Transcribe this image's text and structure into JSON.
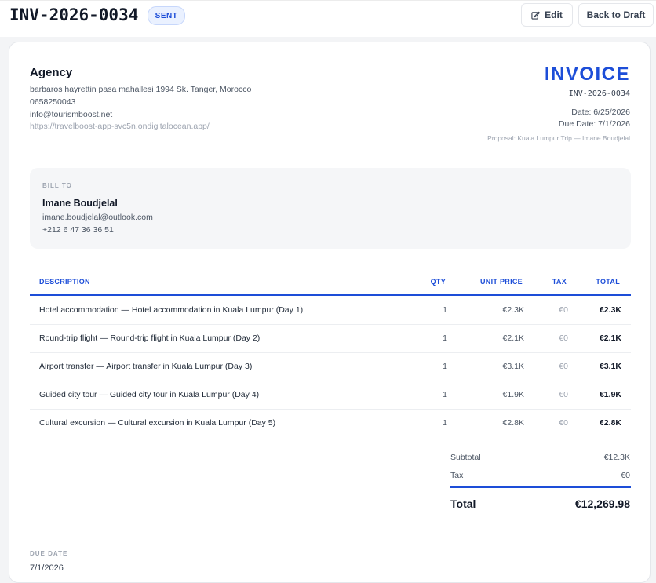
{
  "header": {
    "invoice_id": "INV-2026-0034",
    "status": "SENT",
    "edit_label": "Edit",
    "back_label": "Back to Draft"
  },
  "agency": {
    "name": "Agency",
    "address": "barbaros hayrettin pasa mahallesi 1994 Sk. Tanger, Morocco",
    "phone": "0658250043",
    "email": "info@tourismboost.net",
    "website": "https://travelboost-app-svc5n.ondigitalocean.app/"
  },
  "invoice": {
    "title": "INVOICE",
    "number": "INV-2026-0034",
    "date": "Date: 6/25/2026",
    "due_date": "Due Date: 7/1/2026",
    "proposal": "Proposal: Kuala Lumpur Trip — Imane Boudjelal"
  },
  "bill_to": {
    "label": "BILL TO",
    "name": "Imane Boudjelal",
    "email": "imane.boudjelal@outlook.com",
    "phone": "+212 6 47 36 36 51"
  },
  "table": {
    "headers": {
      "description": "DESCRIPTION",
      "qty": "QTY",
      "unit_price": "UNIT PRICE",
      "tax": "TAX",
      "total": "TOTAL"
    },
    "rows": [
      {
        "description": "Hotel accommodation — Hotel accommodation in Kuala Lumpur (Day 1)",
        "qty": "1",
        "unit_price": "€2.3K",
        "tax": "€0",
        "total": "€2.3K"
      },
      {
        "description": "Round-trip flight — Round-trip flight in Kuala Lumpur (Day 2)",
        "qty": "1",
        "unit_price": "€2.1K",
        "tax": "€0",
        "total": "€2.1K"
      },
      {
        "description": "Airport transfer — Airport transfer in Kuala Lumpur (Day 3)",
        "qty": "1",
        "unit_price": "€3.1K",
        "tax": "€0",
        "total": "€3.1K"
      },
      {
        "description": "Guided city tour — Guided city tour in Kuala Lumpur (Day 4)",
        "qty": "1",
        "unit_price": "€1.9K",
        "tax": "€0",
        "total": "€1.9K"
      },
      {
        "description": "Cultural excursion — Cultural excursion in Kuala Lumpur (Day 5)",
        "qty": "1",
        "unit_price": "€2.8K",
        "tax": "€0",
        "total": "€2.8K"
      }
    ]
  },
  "summary": {
    "subtotal_label": "Subtotal",
    "subtotal": "€12.3K",
    "tax_label": "Tax",
    "tax": "€0",
    "total_label": "Total",
    "total": "€12,269.98"
  },
  "footer": {
    "due_label": "DUE DATE",
    "due_value": "7/1/2026"
  },
  "colors": {
    "accent": "#1d4ed8",
    "badge_bg": "#eaf1ff"
  },
  "icons": {
    "edit": "edit-icon"
  }
}
